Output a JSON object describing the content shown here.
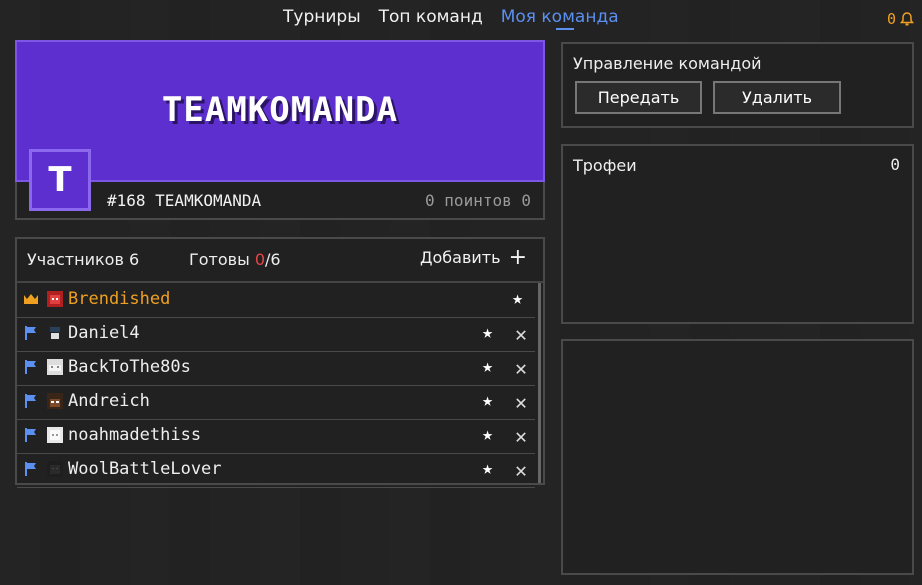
{
  "nav": {
    "tabs": [
      {
        "label": "Турниры"
      },
      {
        "label": "Топ команд"
      },
      {
        "label": "Моя команда"
      }
    ],
    "notifications_count": "0"
  },
  "team": {
    "banner_name": "TEAMKOMANDA",
    "avatar_letter": "T",
    "rank_line": "#168 TEAMKOMANDA",
    "points_line": "0 поинтов 0",
    "banner_color": "#5e2fcf"
  },
  "members": {
    "count_label": "Участников 6",
    "ready_label": "Готовы",
    "ready_num": "0",
    "ready_total": "/6",
    "add_label": "Добавить",
    "rows": [
      {
        "name": "Brendished",
        "role": "crown-icon"
      },
      {
        "name": "Daniel4",
        "role": "flag-icon"
      },
      {
        "name": "BackToThe80s",
        "role": "flag-icon"
      },
      {
        "name": "Andreich",
        "role": "flag-icon"
      },
      {
        "name": "noahmadethiss",
        "role": "flag-icon"
      },
      {
        "name": "WoolBattleLover",
        "role": "flag-icon"
      }
    ]
  },
  "manage": {
    "title": "Управление командой",
    "transfer_label": "Передать",
    "delete_label": "Удалить"
  },
  "trophies": {
    "title": "Трофеи",
    "count": "0"
  },
  "colors": {
    "accent": "#5b8ff0",
    "leader": "#f0a020",
    "ready_red": "#e84545"
  }
}
